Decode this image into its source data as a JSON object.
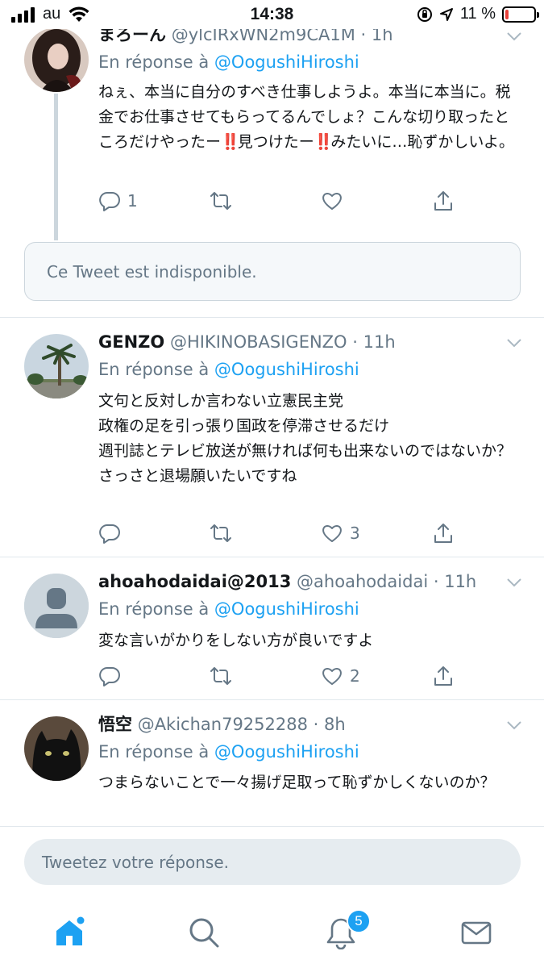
{
  "status_bar": {
    "carrier": "au",
    "time": "14:38",
    "battery_text": "11 %",
    "battery_level": 0.11,
    "battery_color": "#e8413b"
  },
  "tweets": [
    {
      "display_name": "まろーん",
      "handle": "@ylcIRxWN2m9CA1M",
      "separator": " · ",
      "time": "1h",
      "reply_prefix": "En réponse à ",
      "reply_to": "@OogushiHiroshi",
      "text_parts": [
        "ねぇ、本当に自分のすべき仕事しようよ。本当に本当に。税金でお仕事させてもらってるんでしょ？こんな切り取ったところだけやったー",
        "‼️",
        "見つけたー",
        "‼️",
        "みたいに…恥ずかしいよ。"
      ],
      "reply_count": "1",
      "retweet_count": "",
      "like_count": "",
      "avatar_icon": "woman-portrait-avatar"
    },
    {
      "display_name": "GENZO",
      "handle": "@HIKINOBASIGENZO",
      "separator": " · ",
      "time": "11h",
      "reply_prefix": "En réponse à ",
      "reply_to": "@OogushiHiroshi",
      "text": "文句と反対しか言わない立憲民主党\n政権の足を引っ張り国政を停滞させるだけ\n週刊誌とテレビ放送が無ければ何も出来ないのではないか？\nさっさと退場願いたいですね",
      "reply_count": "",
      "retweet_count": "",
      "like_count": "3",
      "avatar_icon": "palm-tree-avatar"
    },
    {
      "display_name": "ahoahodaidai@2013",
      "handle": "@ahoahodaidai",
      "separator": " · ",
      "time": "11h",
      "reply_prefix": "En réponse à ",
      "reply_to": "@OogushiHiroshi",
      "text": "変な言いがかりをしない方が良いですよ",
      "reply_count": "",
      "retweet_count": "",
      "like_count": "2",
      "avatar_icon": "default-person-avatar"
    },
    {
      "display_name": "悟空",
      "handle": "@Akichan79252288",
      "separator": " · ",
      "time": "8h",
      "reply_prefix": "En réponse à ",
      "reply_to": "@OogushiHiroshi",
      "text": "つまらないことで一々揚げ足取って恥ずかしくないのか？",
      "avatar_icon": "black-cat-avatar"
    }
  ],
  "unavailable_text": "Ce Tweet est indisponible.",
  "reply_box": {
    "placeholder": "Tweetez votre réponse."
  },
  "nav": {
    "notification_badge": "5",
    "accent_color": "#1da1f2",
    "items": [
      "home-icon",
      "search-icon",
      "notifications-icon",
      "messages-icon"
    ]
  }
}
